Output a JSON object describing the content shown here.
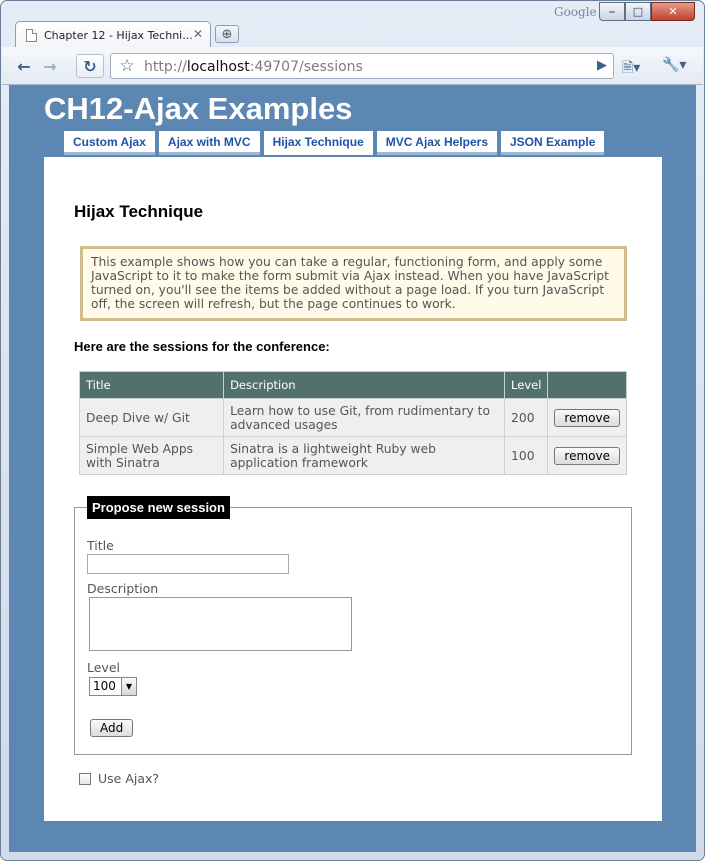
{
  "browser": {
    "google_label": "Google",
    "tab_title": "Chapter 12 - Hijax Techni...",
    "url_protocol": "http://",
    "url_host": "localhost",
    "url_rest": ":49707/sessions"
  },
  "site": {
    "title": "CH12-Ajax Examples",
    "menu": [
      {
        "label": "Custom Ajax"
      },
      {
        "label": "Ajax with MVC"
      },
      {
        "label": "Hijax Technique"
      },
      {
        "label": "MVC Ajax Helpers"
      },
      {
        "label": "JSON Example"
      }
    ]
  },
  "page": {
    "heading": "Hijax Technique",
    "notice": "This example shows how you can take a regular, functioning form, and apply some JavaScript to it to make the form submit via Ajax instead. When you have JavaScript turned on, you'll see the items be added without a page load. If you turn JavaScript off, the screen will refresh, but the page continues to work.",
    "sessions_label": "Here are the sessions for the conference:"
  },
  "table": {
    "headers": [
      "Title",
      "Description",
      "Level",
      ""
    ],
    "rows": [
      {
        "title": "Deep Dive w/ Git",
        "description": "Learn how to use Git, from rudimentary to advanced usages",
        "level": "200",
        "action": "remove"
      },
      {
        "title": "Simple Web Apps with Sinatra",
        "description": "Sinatra is a lightweight Ruby web application framework",
        "level": "100",
        "action": "remove"
      }
    ]
  },
  "form": {
    "legend": "Propose new session",
    "title_label": "Title",
    "title_value": "",
    "description_label": "Description",
    "description_value": "",
    "level_label": "Level",
    "level_value": "100",
    "add_label": "Add",
    "use_ajax_label": "Use Ajax?",
    "use_ajax_checked": false
  }
}
